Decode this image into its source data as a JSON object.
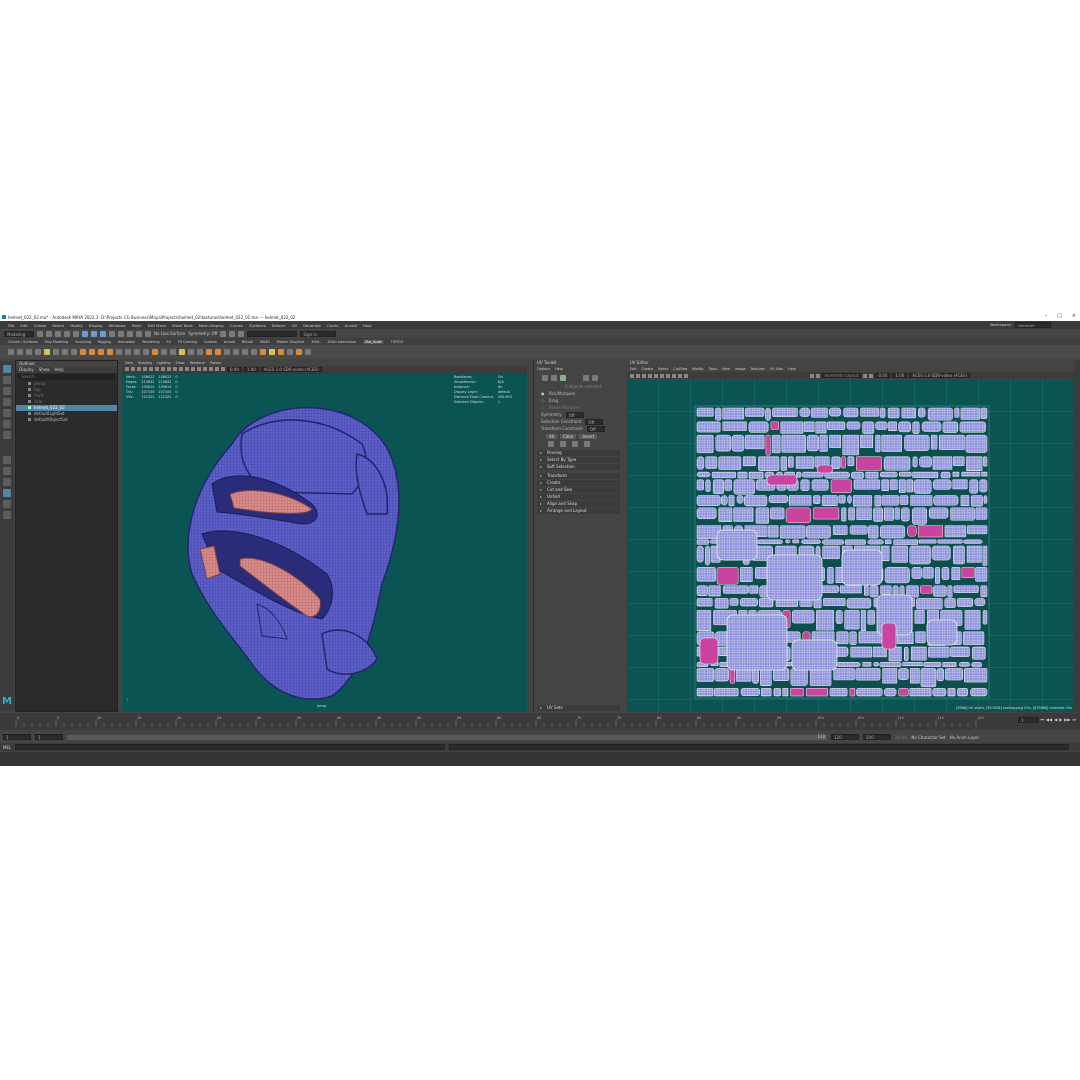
{
  "titlebar": {
    "title": "helmet_022_02.ma* - Autodesk MAYA 2022.3: D:\\Projects CG Business\\Maya\\Projects\\helmet_02\\textures\\helmet_022_02.ma ---  helmet_022_02",
    "window_buttons": [
      "–",
      "□",
      "×"
    ]
  },
  "menubar": {
    "items": [
      "File",
      "Edit",
      "Create",
      "Select",
      "Modify",
      "Display",
      "Windows",
      "Mesh",
      "Edit Mesh",
      "Mesh Tools",
      "Mesh Display",
      "Curves",
      "Surfaces",
      "Deform",
      "UV",
      "Generate",
      "Cache",
      "Arnold",
      "Help"
    ],
    "workspace_label": "Workspace:",
    "workspace_value": "General*"
  },
  "statusline": {
    "mode": "Modeling",
    "live_surface": "No Live Surface",
    "symmetry": "Symmetry: Off",
    "sign_in": "Sign In"
  },
  "shelf_tabs": {
    "items": [
      "Curves / Surfaces",
      "Poly Modeling",
      "Sculpting",
      "Rigging",
      "Animation",
      "Rendering",
      "FX",
      "FX Caching",
      "Custom",
      "Arnold",
      "Bifrost",
      "MASH",
      "Motion Graphics",
      "XGen",
      "XGen Interactive",
      "Zbs_Scott",
      "TURTLE"
    ],
    "active": "Zbs_Scott"
  },
  "outliner": {
    "title": "Outliner",
    "menu": [
      "Display",
      "Show",
      "Help"
    ],
    "search_placeholder": "Search...",
    "items": [
      "persp",
      "top",
      "front",
      "side",
      "helmet_022_02",
      "defaultLightSet",
      "defaultObjectSet"
    ],
    "selected": "helmet_022_02"
  },
  "viewport": {
    "menu": [
      "View",
      "Shading",
      "Lighting",
      "Show",
      "Renderer",
      "Panels"
    ],
    "exposure": "0.00",
    "gamma": "1.00",
    "color_space": "ACES 1.0 SDR-video (ACES)",
    "camera_label": "persp",
    "stats": [
      {
        "label": "Verts:",
        "a": "108022",
        "b": "108022",
        "c": "0"
      },
      {
        "label": "Edges:",
        "a": "215832",
        "b": "215832",
        "c": "0"
      },
      {
        "label": "Faces:",
        "a": "105814",
        "b": "105814",
        "c": "0"
      },
      {
        "label": "Tris:",
        "a": "207100",
        "b": "207100",
        "c": "0"
      },
      {
        "label": "UVs:",
        "a": "121322",
        "b": "121322",
        "c": "0"
      }
    ],
    "info": [
      {
        "label": "Backfaces:",
        "value": "On"
      },
      {
        "label": "Smoothness:",
        "value": "N/A"
      },
      {
        "label": "Instance:",
        "value": "No"
      },
      {
        "label": "Display Layer:",
        "value": "default"
      },
      {
        "label": "Distance From Camera:",
        "value": "200.893"
      },
      {
        "label": "Selected Objects:",
        "value": "1"
      }
    ]
  },
  "uv_toolkit": {
    "title": "UV Toolkit",
    "menu": [
      "Options",
      "Help"
    ],
    "no_selection": "0 objects selected",
    "pick_options": [
      "Pick/Marquee",
      "Drag",
      "Tweak Marquee"
    ],
    "symmetry_label": "Symmetry",
    "symmetry_value": "Off",
    "constraint1_label": "Selection Constraint",
    "constraint1_value": "Off",
    "constraint2_label": "Transform Constraint",
    "constraint2_value": "Off",
    "buttons": [
      "All",
      "Clear",
      "Invert"
    ],
    "sections": [
      "Pinning",
      "Select By Type",
      "Soft Selection",
      "Transform",
      "Create",
      "Cut and Sew",
      "Unfold",
      "Align and Snap",
      "Arrange and Layout"
    ],
    "footer_section": "UV Sets"
  },
  "uv_editor": {
    "title": "UV Editor",
    "menu": [
      "Edit",
      "Create",
      "Select",
      "Cut/Sew",
      "Modify",
      "Tools",
      "View",
      "Image",
      "Textures",
      "UV Sets",
      "Help"
    ],
    "uv_set": "Isometric Layout",
    "exposure": "0.00",
    "gamma": "1.00",
    "color_space": "ACES 1.0 SDR-video (ACES)",
    "status": "[8568] UV shells, [821928] overlapping UVs, [879868] reversed UVs"
  },
  "timeline": {
    "ticks": [
      "0",
      "5",
      "10",
      "15",
      "20",
      "25",
      "30",
      "35",
      "40",
      "45",
      "50",
      "55",
      "60",
      "65",
      "70",
      "75",
      "80",
      "85",
      "90",
      "95",
      "100",
      "105",
      "110",
      "115",
      "120"
    ],
    "current_frame": "1"
  },
  "range": {
    "start": "1",
    "inner_start": "1",
    "inner_end": "120",
    "end": "120",
    "outer_end": "200",
    "fps": "24 fps",
    "character_set": "No Character Set",
    "anim_layer": "No Anim Layer"
  },
  "command": {
    "lang": "MEL"
  },
  "colors": {
    "viewport_bg": "#0a5454",
    "mesh_blue": "#5c5fc8",
    "mesh_pink": "#d98b8a",
    "uv_shell": "#9b9ee0",
    "uv_overlap": "#c9449f",
    "selection": "#5285a6"
  }
}
